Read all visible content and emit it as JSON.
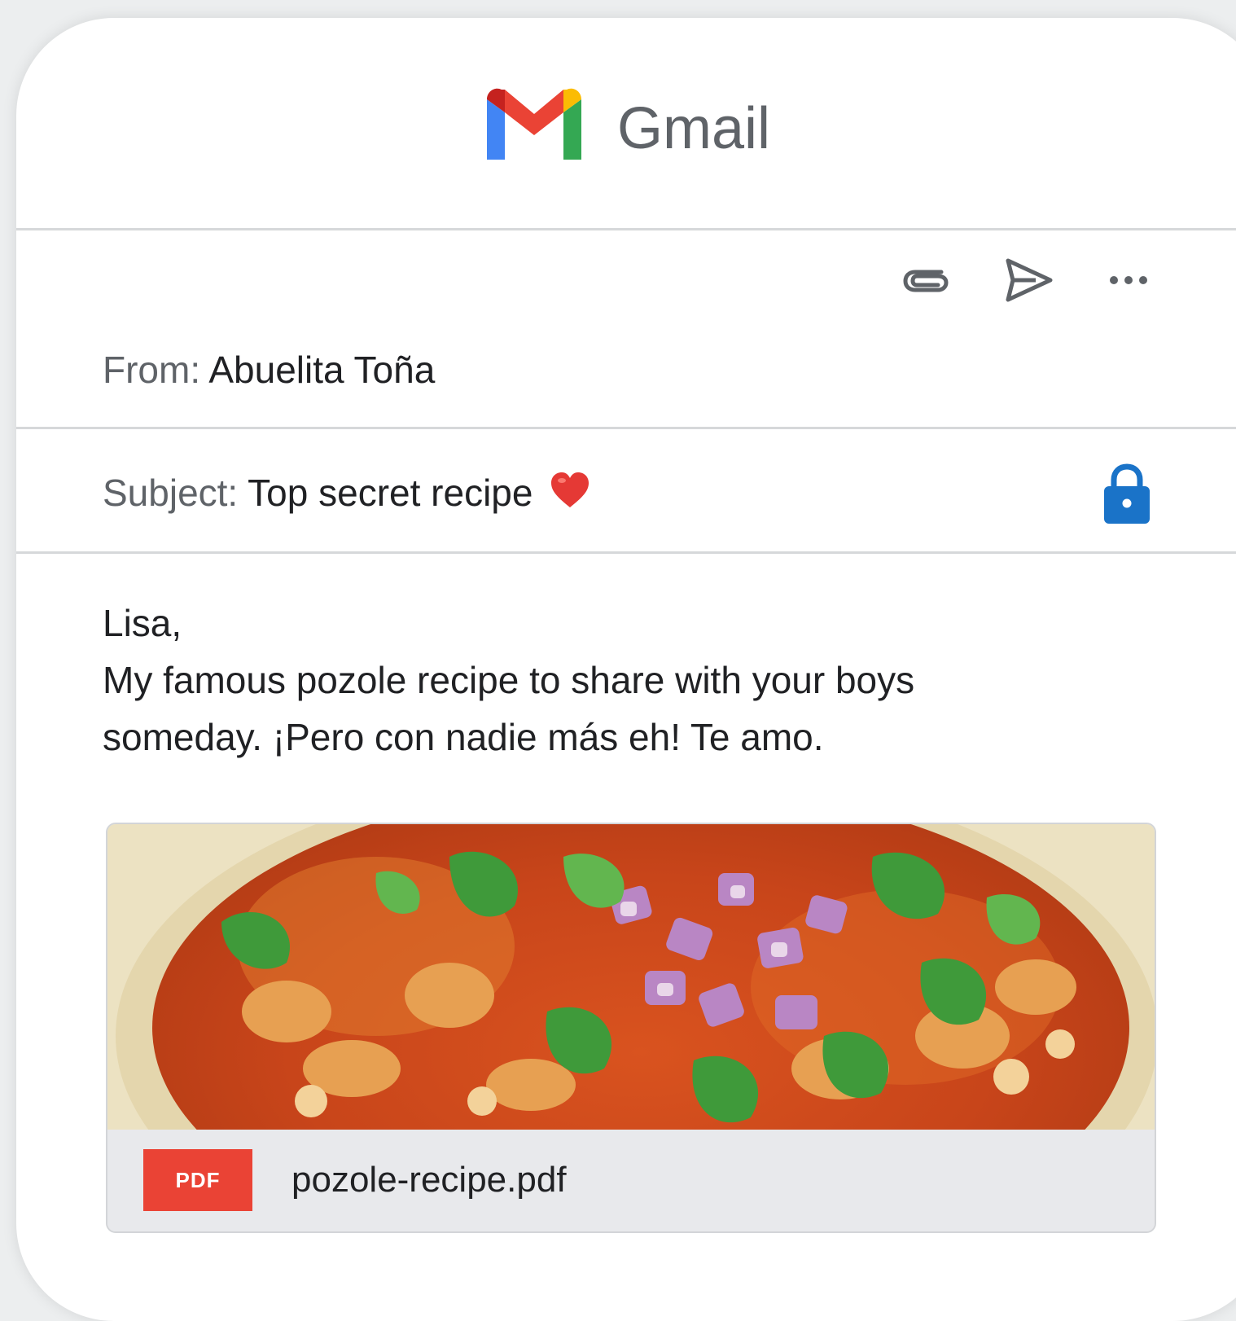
{
  "app": {
    "name": "Gmail"
  },
  "toolbar": {
    "attach_icon": "paperclip-icon",
    "send_icon": "send-icon",
    "more_icon": "more-horizontal-icon"
  },
  "email": {
    "from_label": "From:",
    "from_value": "Abuelita Toña",
    "subject_label": "Subject:",
    "subject_value": "Top secret recipe",
    "subject_emoji": "heart-icon",
    "security_icon": "lock-icon",
    "body_lines": [
      "Lisa,",
      "My famous pozole recipe to share with your boys",
      "someday. ¡Pero con nadie más eh! Te amo."
    ]
  },
  "attachment": {
    "badge": "PDF",
    "file_name": "pozole-recipe.pdf"
  },
  "colors": {
    "gmail_red": "#EA4335",
    "gmail_blue": "#4285F4",
    "gmail_green": "#34A853",
    "gmail_yellow": "#FBBC04",
    "lock_blue": "#1a73c8",
    "heart_red": "#e53935"
  }
}
